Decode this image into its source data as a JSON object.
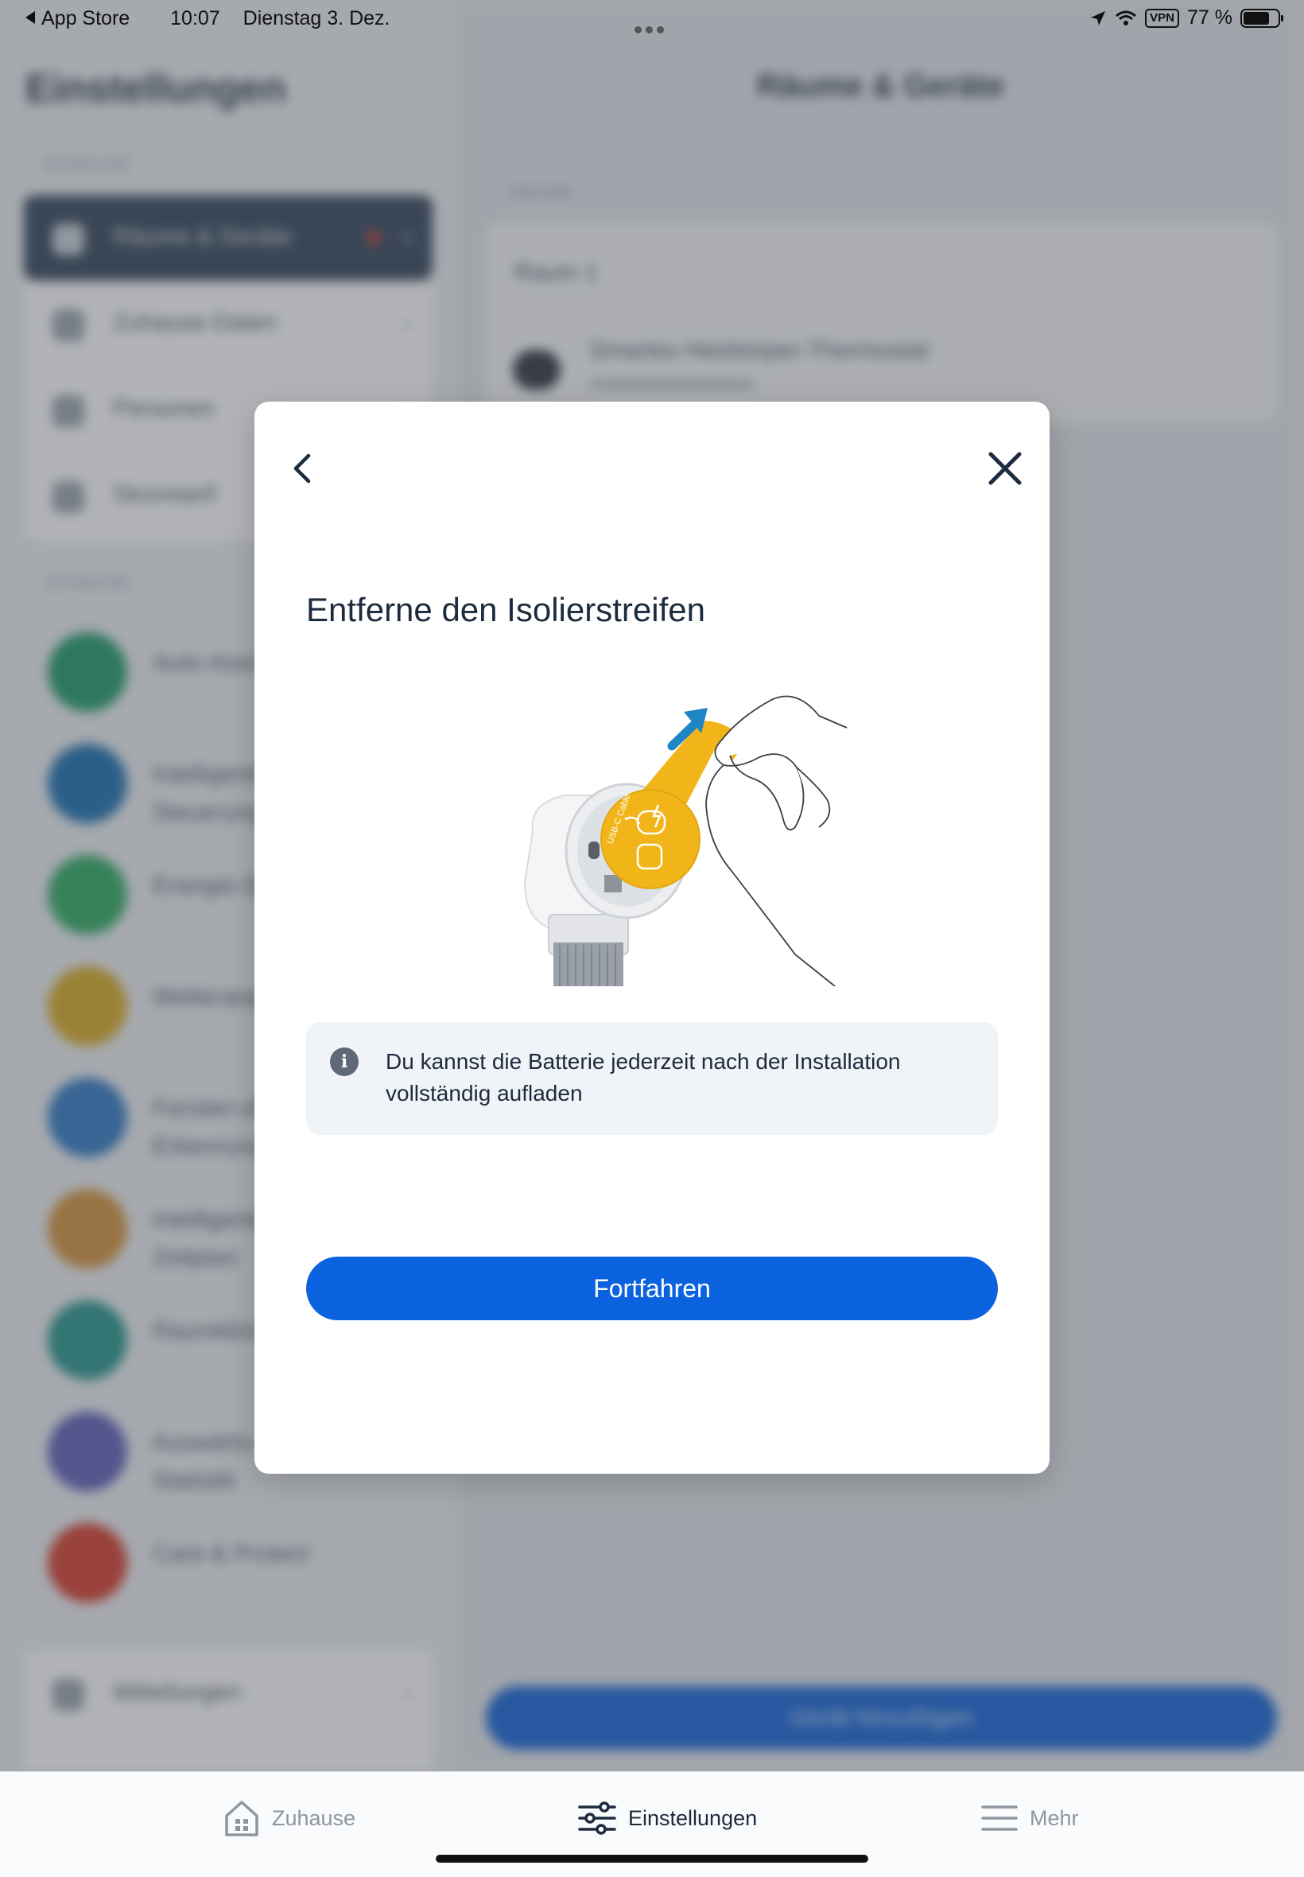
{
  "status_bar": {
    "back_app": "App Store",
    "time": "10:07",
    "date": "Dienstag 3. Dez.",
    "vpn": "VPN",
    "battery": "77 %",
    "battery_level": 0.77
  },
  "background": {
    "sidebar_title": "Einstellungen",
    "section_top": "ZUHAUSE",
    "section_roles": "ROLLE",
    "menu": [
      "Räume & Geräte",
      "Zuhause-Daten",
      "Personen",
      "Stromtarif"
    ],
    "circle_items": [
      {
        "label": "Auto-Assist",
        "color": "#1f9a68"
      },
      {
        "label": "Intelligente\nSteuerung",
        "color": "#1b6fb0"
      },
      {
        "label": "Energie-Spar",
        "color": "#2eaa62"
      },
      {
        "label": "Wetteranpassung",
        "color": "#d8aa22"
      },
      {
        "label": "Fenster-offen-\nErkennung",
        "color": "#2f79c4"
      },
      {
        "label": "Intelligenter\nZeitplan",
        "color": "#d4923a"
      },
      {
        "label": "Raumklima",
        "color": "#25958c"
      },
      {
        "label": "Auswärts-\nStatistik",
        "color": "#5d5fb8"
      },
      {
        "label": "Care & Protect",
        "color": "#d63c2b"
      }
    ],
    "bottom_menu": "Mitteilungen",
    "main_title": "Räume & Geräte",
    "main_section": "RÄUME",
    "room": "Raum 1",
    "device": "Smartes Heizkörper-Thermostat",
    "add_button": "Gerät hinzufügen"
  },
  "modal": {
    "title": "Entferne den Isolierstreifen",
    "info_text": "Du kannst die Batterie jederzeit nach der Installation vollständig aufladen",
    "button": "Fortfahren",
    "illustration_tab_text": "USB-C Cable",
    "back_icon": "chevron-left-icon",
    "close_icon": "close-icon"
  },
  "tab_bar": {
    "items": [
      {
        "label": "Zuhause",
        "icon": "home-icon",
        "active": false
      },
      {
        "label": "Einstellungen",
        "icon": "sliders-icon",
        "active": true
      },
      {
        "label": "Mehr",
        "icon": "menu-icon",
        "active": false
      }
    ]
  },
  "colors": {
    "primary": "#0a62de",
    "title_text": "#1c2b3d",
    "info_bg": "#f0f3f7",
    "tape_yellow": "#f2b519",
    "arrow_blue": "#1e86c4"
  }
}
